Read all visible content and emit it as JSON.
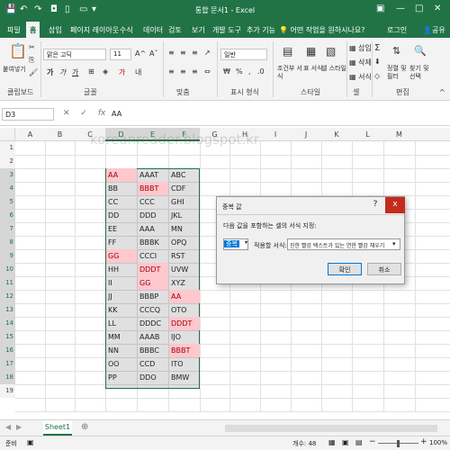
{
  "window": {
    "title": "통합 문서1 - Excel",
    "search": "어떤 작업을 원하시나요?",
    "share": "공유",
    "user": "로그인"
  },
  "tabs": [
    "파일",
    "홈",
    "삽입",
    "페이지 레이아웃",
    "수식",
    "데이터",
    "검토",
    "보기",
    "개발 도구",
    "추가 기능"
  ],
  "ribbon": {
    "paste": "붙여넣기",
    "font_name": "맑은 고딕",
    "font_size": "11",
    "number_format": "일반",
    "cond_format": "조건부 서식",
    "table_format": "표 서식",
    "cell_style": "셀 스타일",
    "insert": "삽입",
    "delete": "삭제",
    "format": "서식",
    "sort_filter": "정렬 및 필터",
    "find_select": "찾기 및 선택",
    "groups": {
      "clipboard": "클립보드",
      "font": "글꼴",
      "alignment": "맞춤",
      "number": "표시 형식",
      "styles": "스타일",
      "cells": "셀",
      "editing": "편집"
    }
  },
  "formula_bar": {
    "cell_ref": "D3",
    "value": "AA"
  },
  "columns": [
    "A",
    "B",
    "C",
    "D",
    "E",
    "F",
    "G",
    "H",
    "I",
    "J",
    "K",
    "L",
    "M"
  ],
  "rows": [
    "1",
    "2",
    "3",
    "4",
    "5",
    "6",
    "7",
    "8",
    "9",
    "10",
    "11",
    "12",
    "13",
    "14",
    "15",
    "16",
    "17",
    "18",
    "19"
  ],
  "data": [
    [
      "AA",
      "AAAT",
      "ABC"
    ],
    [
      "BB",
      "BBBT",
      "CDF"
    ],
    [
      "CC",
      "CCC",
      "GHI"
    ],
    [
      "DD",
      "DDD",
      "JKL"
    ],
    [
      "EE",
      "AAA",
      "MN"
    ],
    [
      "FF",
      "BBBK",
      "OPQ"
    ],
    [
      "GG",
      "CCCI",
      "RST"
    ],
    [
      "HH",
      "DDDT",
      "UVW"
    ],
    [
      "II",
      "GG",
      "XYZ"
    ],
    [
      "JJ",
      "BBBP",
      "AA"
    ],
    [
      "KK",
      "CCCQ",
      "OTO"
    ],
    [
      "LL",
      "DDDC",
      "DDDT"
    ],
    [
      "MM",
      "AAAB",
      "IJO"
    ],
    [
      "NN",
      "BBBC",
      "BBBT"
    ],
    [
      "OO",
      "CCD",
      "ITO"
    ],
    [
      "PP",
      "DDO",
      "BMW"
    ]
  ],
  "highlights": [
    [
      0,
      0
    ],
    [
      1,
      1
    ],
    [
      6,
      0
    ],
    [
      7,
      1
    ],
    [
      8,
      1
    ],
    [
      9,
      2
    ],
    [
      11,
      2
    ],
    [
      13,
      2
    ]
  ],
  "dialog": {
    "title": "중복 값",
    "help": "?",
    "close": "x",
    "prompt": "다음 값을 포함하는 셀의 서식 지정:",
    "type": "중복",
    "with_label": "적용할 서식:",
    "format": "진한 빨강 텍스트가 있는 연한 빨강 채우기",
    "ok": "확인",
    "cancel": "취소"
  },
  "sheet": {
    "tab": "Sheet1"
  },
  "status": {
    "ready": "준비",
    "count": "개수: 48",
    "zoom": "100%"
  },
  "watermark": "koreanreader.blogspot.kr",
  "colors": {
    "accent": "#217346",
    "highlight_fill": "#ffc7ce",
    "highlight_text": "#9c0006",
    "dialog_close": "#c42b1c"
  }
}
